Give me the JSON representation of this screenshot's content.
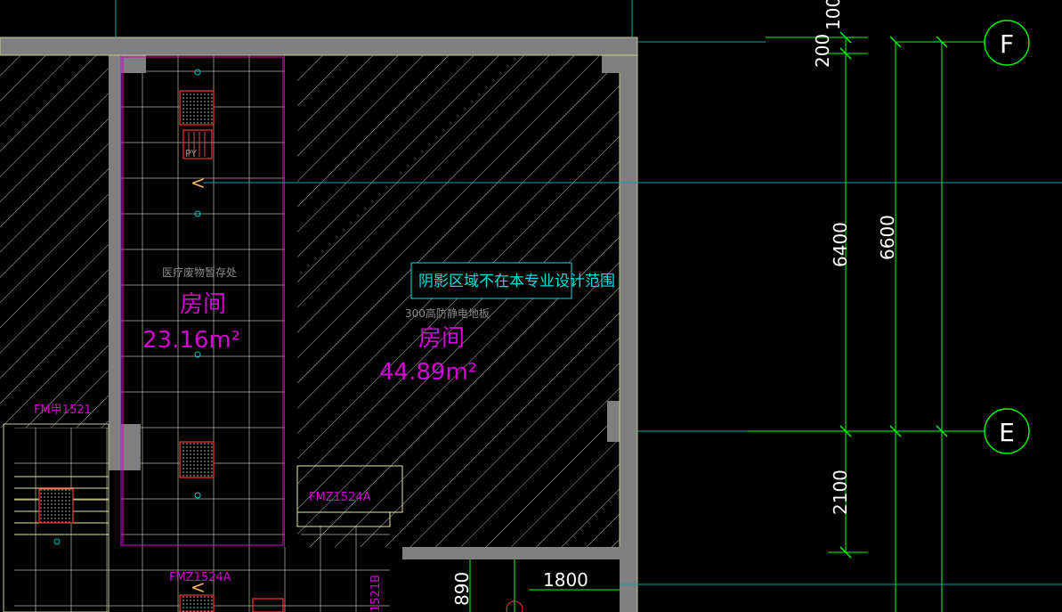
{
  "drawing": {
    "axes": [
      {
        "id": "F",
        "label": "F"
      },
      {
        "id": "E",
        "label": "E"
      }
    ],
    "dimensions": {
      "d100": "100",
      "d200": "200",
      "d6400": "6400",
      "d6600": "6600",
      "d2100": "2100",
      "d890": "890",
      "d1800": "1800"
    },
    "rooms": [
      {
        "name": "房间",
        "area": "23.16m²",
        "note": "医疗废物暂存处"
      },
      {
        "name": "房间",
        "area": "44.89m²",
        "note": "300高防静电地板"
      }
    ],
    "doors": {
      "fm1": "FM甲1521",
      "fmz1": "FMZ1524A",
      "fmz2": "FMZ1524A",
      "fm3": "1521B"
    },
    "notes": {
      "shadow_area": "阴影区域不在本专业设计范围"
    },
    "markers": {
      "py": "PY",
      "arrow": "<"
    },
    "colors": {
      "background": "#000000",
      "wall": "#808080",
      "grid_line": "#00ff00",
      "axis_line": "#00a8a8",
      "room_text": "#d400d4",
      "note_text": "#00e0e0",
      "hatch": "#c8c8c8",
      "tile": "#b8b8a0",
      "equipment": "#ff3030"
    }
  }
}
